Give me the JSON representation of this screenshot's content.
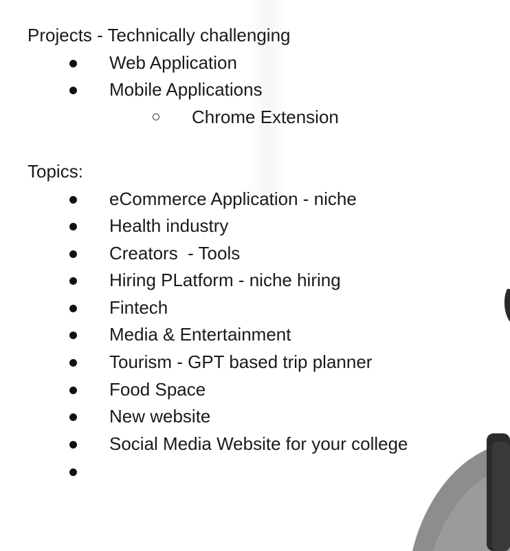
{
  "projects": {
    "heading": "Projects - Technically challenging",
    "items": [
      {
        "label": "Web Application"
      },
      {
        "label": "Mobile Applications"
      }
    ],
    "subitems": [
      {
        "label": "Chrome Extension"
      }
    ]
  },
  "topics": {
    "heading": "Topics:",
    "items": [
      {
        "label": "eCommerce Application - niche"
      },
      {
        "label": "Health industry"
      },
      {
        "label": "Creators  - Tools"
      },
      {
        "label": "Hiring PLatform - niche hiring"
      },
      {
        "label": "Fintech"
      },
      {
        "label": "Media & Entertainment"
      },
      {
        "label": "Tourism - GPT based trip planner"
      },
      {
        "label": "Food Space"
      },
      {
        "label": "New website"
      },
      {
        "label": "Social Media Website for your college"
      },
      {
        "label": ""
      }
    ]
  },
  "presenter": {
    "icon": "presenter-silhouette-icon"
  }
}
